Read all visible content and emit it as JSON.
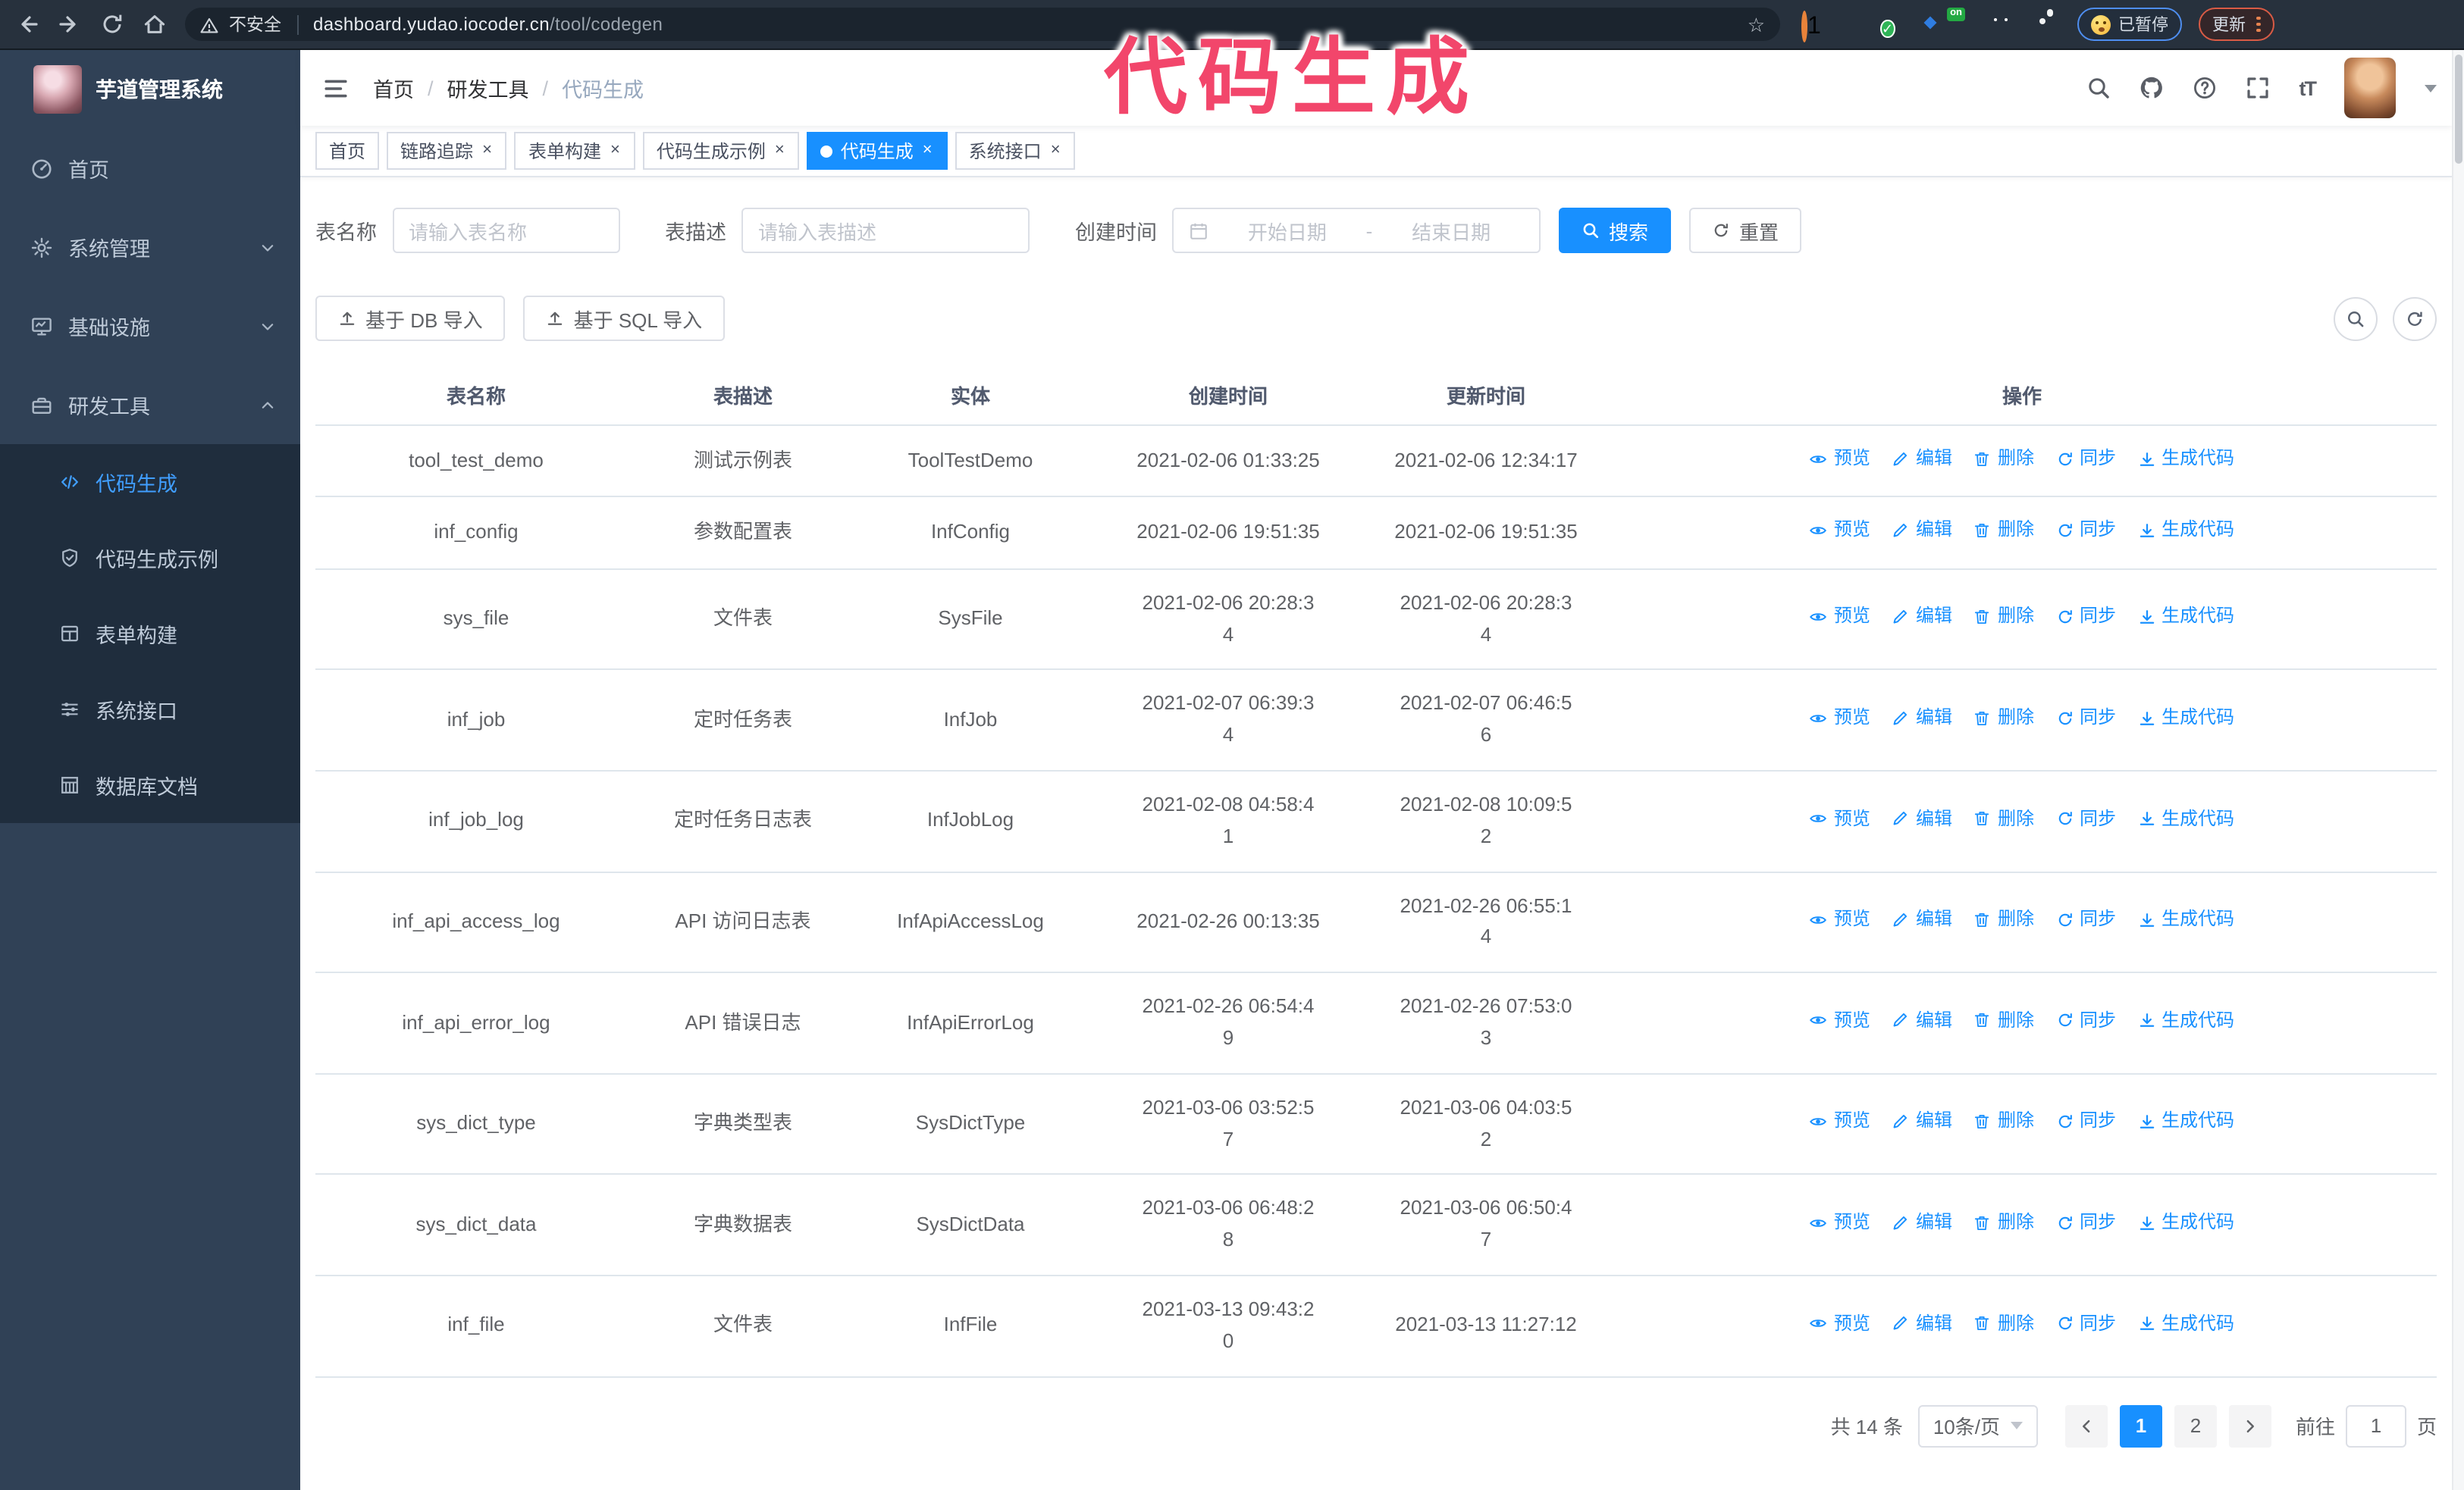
{
  "browser": {
    "security_label": "不安全",
    "url_host": "dashboard.yudao.iocoder.cn",
    "url_path": "/tool/codegen",
    "extension_badge": "1",
    "extension_on_badge": "on",
    "paused_badge": "已暂停",
    "update_button": "更新"
  },
  "annotation": {
    "text": "代码生成",
    "color": "#f2466b"
  },
  "sidebar": {
    "title": "芋道管理系统",
    "items": [
      {
        "key": "home",
        "label": "首页",
        "icon": "dashboard",
        "expandable": false
      },
      {
        "key": "system",
        "label": "系统管理",
        "icon": "gear",
        "expandable": true,
        "expanded": false
      },
      {
        "key": "infra",
        "label": "基础设施",
        "icon": "monitor",
        "expandable": true,
        "expanded": false
      },
      {
        "key": "devtools",
        "label": "研发工具",
        "icon": "toolbox",
        "expandable": true,
        "expanded": true
      }
    ],
    "subitems": [
      {
        "key": "codegen",
        "label": "代码生成",
        "icon": "code",
        "active": true
      },
      {
        "key": "codegen-example",
        "label": "代码生成示例",
        "icon": "shield-check",
        "active": false
      },
      {
        "key": "form-builder",
        "label": "表单构建",
        "icon": "form-grid",
        "active": false
      },
      {
        "key": "system-api",
        "label": "系统接口",
        "icon": "sliders",
        "active": false
      },
      {
        "key": "db-doc",
        "label": "数据库文档",
        "icon": "db-table",
        "active": false
      }
    ]
  },
  "header": {
    "breadcrumb": [
      "首页",
      "研发工具",
      "代码生成"
    ],
    "breadcrumb_separator": "/"
  },
  "tabs": [
    {
      "key": "home",
      "label": "首页",
      "closable": false,
      "active": false
    },
    {
      "key": "tracing",
      "label": "链路追踪",
      "closable": true,
      "active": false
    },
    {
      "key": "form-builder",
      "label": "表单构建",
      "closable": true,
      "active": false
    },
    {
      "key": "codegen-example",
      "label": "代码生成示例",
      "closable": true,
      "active": false
    },
    {
      "key": "codegen",
      "label": "代码生成",
      "closable": true,
      "active": true
    },
    {
      "key": "system-api",
      "label": "系统接口",
      "closable": true,
      "active": false
    }
  ],
  "search_form": {
    "name_label": "表名称",
    "name_placeholder": "请输入表名称",
    "desc_label": "表描述",
    "desc_placeholder": "请输入表描述",
    "time_label": "创建时间",
    "start_placeholder": "开始日期",
    "range_separator": "-",
    "end_placeholder": "结束日期",
    "search_button": "搜索",
    "reset_button": "重置"
  },
  "toolbar": {
    "db_import_button": "基于 DB 导入",
    "sql_import_button": "基于 SQL 导入"
  },
  "table": {
    "columns": [
      "表名称",
      "表描述",
      "实体",
      "创建时间",
      "更新时间",
      "操作"
    ],
    "actions": [
      {
        "key": "preview",
        "label": "预览",
        "icon": "eye"
      },
      {
        "key": "edit",
        "label": "编辑",
        "icon": "edit"
      },
      {
        "key": "delete",
        "label": "删除",
        "icon": "trash"
      },
      {
        "key": "sync",
        "label": "同步",
        "icon": "sync"
      },
      {
        "key": "generate",
        "label": "生成代码",
        "icon": "download"
      }
    ],
    "rows": [
      {
        "name": "tool_test_demo",
        "desc": "测试示例表",
        "entity": "ToolTestDemo",
        "created": "2021-02-06 01:33:25",
        "updated": "2021-02-06 12:34:17"
      },
      {
        "name": "inf_config",
        "desc": "参数配置表",
        "entity": "InfConfig",
        "created": "2021-02-06 19:51:35",
        "updated": "2021-02-06 19:51:35"
      },
      {
        "name": "sys_file",
        "desc": "文件表",
        "entity": "SysFile",
        "created": "2021-02-06 20:28:3\n4",
        "updated": "2021-02-06 20:28:3\n4"
      },
      {
        "name": "inf_job",
        "desc": "定时任务表",
        "entity": "InfJob",
        "created": "2021-02-07 06:39:3\n4",
        "updated": "2021-02-07 06:46:5\n6"
      },
      {
        "name": "inf_job_log",
        "desc": "定时任务日志表",
        "entity": "InfJobLog",
        "created": "2021-02-08 04:58:4\n1",
        "updated": "2021-02-08 10:09:5\n2"
      },
      {
        "name": "inf_api_access_log",
        "desc": "API 访问日志表",
        "entity": "InfApiAccessLog",
        "created": "2021-02-26 00:13:35",
        "updated": "2021-02-26 06:55:1\n4"
      },
      {
        "name": "inf_api_error_log",
        "desc": "API 错误日志",
        "entity": "InfApiErrorLog",
        "created": "2021-02-26 06:54:4\n9",
        "updated": "2021-02-26 07:53:0\n3"
      },
      {
        "name": "sys_dict_type",
        "desc": "字典类型表",
        "entity": "SysDictType",
        "created": "2021-03-06 03:52:5\n7",
        "updated": "2021-03-06 04:03:5\n2"
      },
      {
        "name": "sys_dict_data",
        "desc": "字典数据表",
        "entity": "SysDictData",
        "created": "2021-03-06 06:48:2\n8",
        "updated": "2021-03-06 06:50:4\n7"
      },
      {
        "name": "inf_file",
        "desc": "文件表",
        "entity": "InfFile",
        "created": "2021-03-13 09:43:2\n0",
        "updated": "2021-03-13 11:27:12"
      }
    ]
  },
  "pagination": {
    "total": "共 14 条",
    "page_size": "10条/页",
    "pages": [
      "1",
      "2"
    ],
    "active_page": "1",
    "goto_label": "前往",
    "goto_value": "1",
    "goto_suffix": "页"
  }
}
